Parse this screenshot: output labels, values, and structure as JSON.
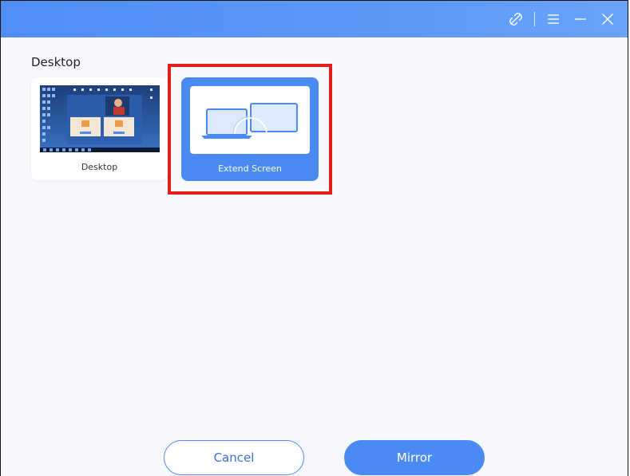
{
  "titlebar": {
    "icons": [
      "unlink-icon",
      "menu-icon",
      "minimize-icon",
      "close-icon"
    ]
  },
  "section": {
    "title": "Desktop"
  },
  "cards": {
    "desktop": {
      "label": "Desktop"
    },
    "extend": {
      "label": "Extend Screen",
      "selected": true
    }
  },
  "buttons": {
    "cancel": "Cancel",
    "mirror": "Mirror"
  },
  "colors": {
    "accent": "#4a8af3",
    "titlebar": "#5a98f8",
    "highlight": "#e51c1c",
    "background": "#f6f8fc"
  }
}
